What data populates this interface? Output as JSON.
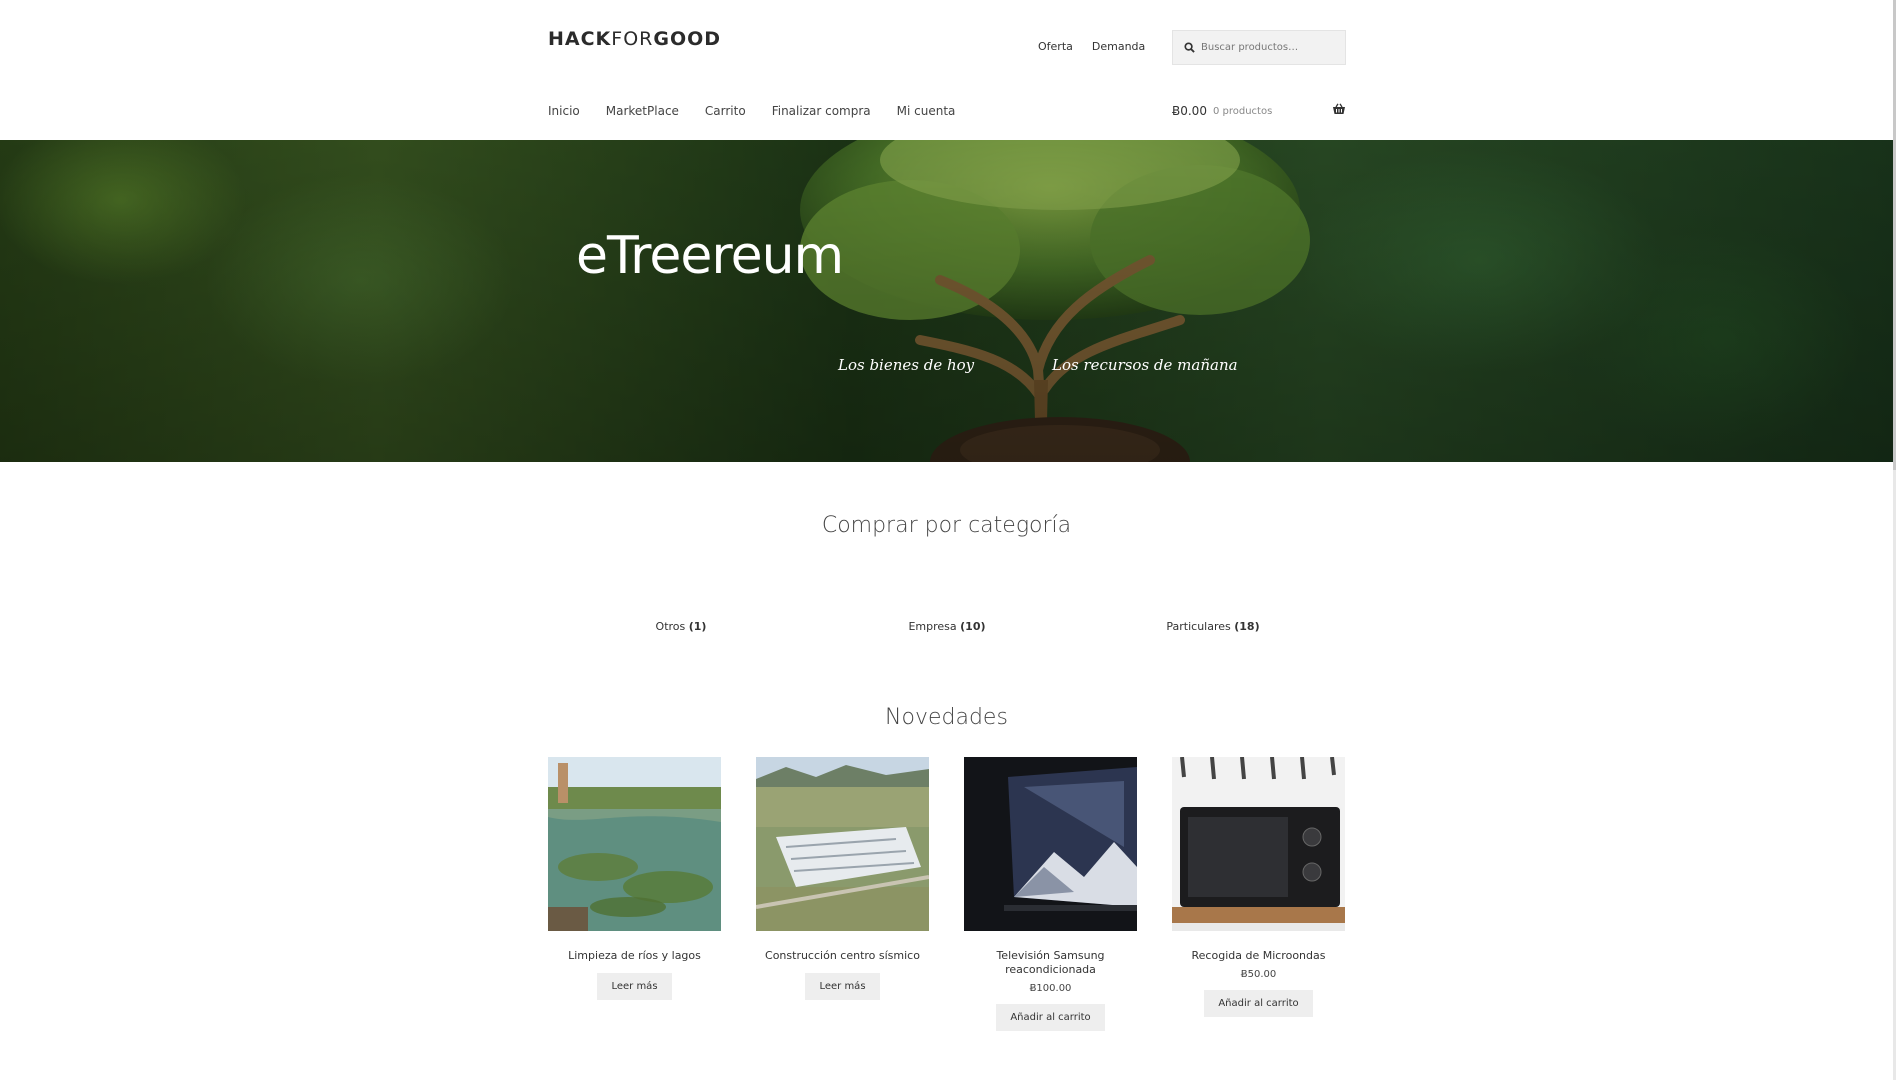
{
  "brand": {
    "logo_bold": "HACK",
    "logo_thin": "FOR",
    "logo_bold2": "GOOD"
  },
  "secondary_nav": [
    "Oferta",
    "Demanda"
  ],
  "search": {
    "placeholder": "Buscar productos…"
  },
  "primary_nav": [
    "Inicio",
    "MarketPlace",
    "Carrito",
    "Finalizar compra",
    "Mi cuenta"
  ],
  "cart": {
    "total": "Ƀ0.00",
    "count": "0 productos"
  },
  "hero": {
    "title": "eTreereum",
    "tagline_left": "Los bienes de hoy",
    "tagline_right": "Los recursos de mañana"
  },
  "categories_section": {
    "title": "Comprar por categoría",
    "items": [
      {
        "name": "Otros",
        "count": "(1)"
      },
      {
        "name": "Empresa",
        "count": "(10)"
      },
      {
        "name": "Particulares",
        "count": "(18)"
      }
    ]
  },
  "products_section": {
    "title": "Novedades",
    "items": [
      {
        "name": "Limpieza de ríos y lagos",
        "price": "",
        "button": "Leer más"
      },
      {
        "name": "Construcción centro sísmico",
        "price": "",
        "button": "Leer más"
      },
      {
        "name": "Televisión Samsung reacondicionada",
        "price": "Ƀ100.00",
        "button": "Añadir al carrito"
      },
      {
        "name": "Recogida de Microondas",
        "price": "Ƀ50.00",
        "button": "Añadir al carrito"
      }
    ]
  },
  "colors": {
    "accent": "#2b2b2b",
    "button_bg": "#eeeeee",
    "hero_green": "#2d5228"
  }
}
